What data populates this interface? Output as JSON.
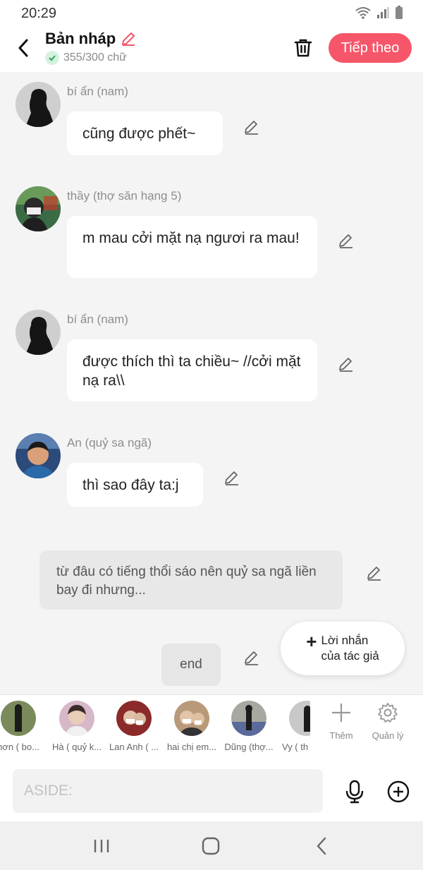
{
  "status": {
    "time": "20:29"
  },
  "header": {
    "title": "Bản nháp",
    "word_count": "355/300 chữ",
    "next_label": "Tiếp theo"
  },
  "messages": [
    {
      "name": "bí ẩn (nam)",
      "text": "cũng được phết~"
    },
    {
      "name": "thầy (thợ săn hạng 5)",
      "text": "m mau cởi mặt nạ ngươi ra mau!"
    },
    {
      "name": "bí ẩn (nam)",
      "text": "được thích thì ta chiều~ //cởi mặt nạ ra\\\\"
    },
    {
      "name": "An (quỷ sa ngã)",
      "text": "thì sao đây ta:j"
    }
  ],
  "narration": "từ đâu có tiếng thổi sáo nên quỷ sa ngã liền bay đi nhưng...",
  "end_label": "end",
  "author_note": "Lời nhắn\ncủa tác giả",
  "characters": [
    {
      "name": "hơn ( bo..."
    },
    {
      "name": "Hà ( quỷ k..."
    },
    {
      "name": "Lan Anh ( ..."
    },
    {
      "name": "hai chị em..."
    },
    {
      "name": "Dũng (thợ..."
    },
    {
      "name": "Vy ( th"
    }
  ],
  "tools": {
    "add_label": "Thêm",
    "manage_label": "Quản lý"
  },
  "composer": {
    "placeholder": "ASIDE:"
  },
  "colors": {
    "accent": "#f5566a",
    "bubble": "#ffffff",
    "background": "#f4f4f4"
  }
}
